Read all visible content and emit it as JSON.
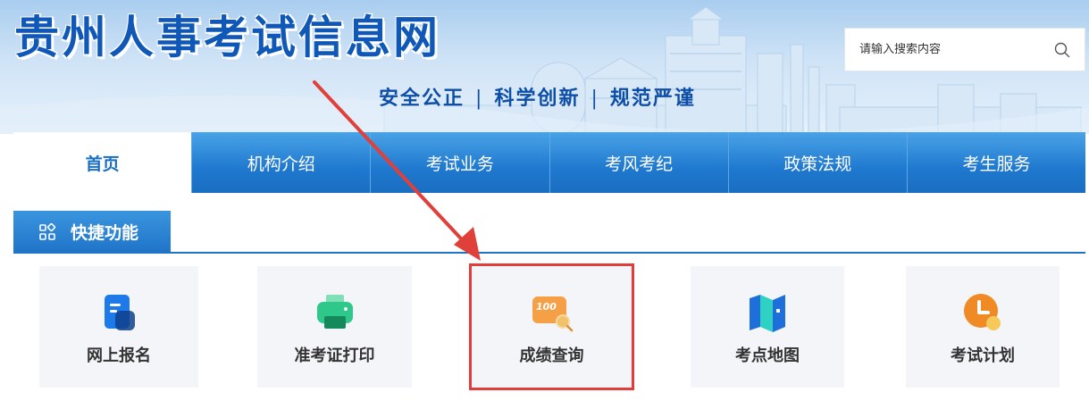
{
  "header": {
    "site_title": "贵州人事考试信息网",
    "slogan": [
      "安全公正",
      "科学创新",
      "规范严谨"
    ],
    "slogan_separator": "|",
    "search": {
      "placeholder": "请输入搜索内容",
      "icon": "search-icon"
    }
  },
  "nav": {
    "items": [
      {
        "label": "首页",
        "active": true
      },
      {
        "label": "机构介绍"
      },
      {
        "label": "考试业务"
      },
      {
        "label": "考风考纪"
      },
      {
        "label": "政策法规"
      },
      {
        "label": "考生服务"
      }
    ]
  },
  "quick": {
    "title": "快捷功能",
    "icon": "apps-grid-icon",
    "cards": [
      {
        "label": "网上报名",
        "icon": "form-document-icon"
      },
      {
        "label": "准考证打印",
        "icon": "printer-icon"
      },
      {
        "label": "成绩查询",
        "icon": "score-100-icon",
        "badge": "100",
        "highlighted": true
      },
      {
        "label": "考点地图",
        "icon": "map-icon"
      },
      {
        "label": "考试计划",
        "icon": "clock-icon"
      }
    ]
  },
  "colors": {
    "brand_blue": "#1f74c8",
    "title_blue": "#0f58b8",
    "highlight_red": "#e23c3c"
  }
}
